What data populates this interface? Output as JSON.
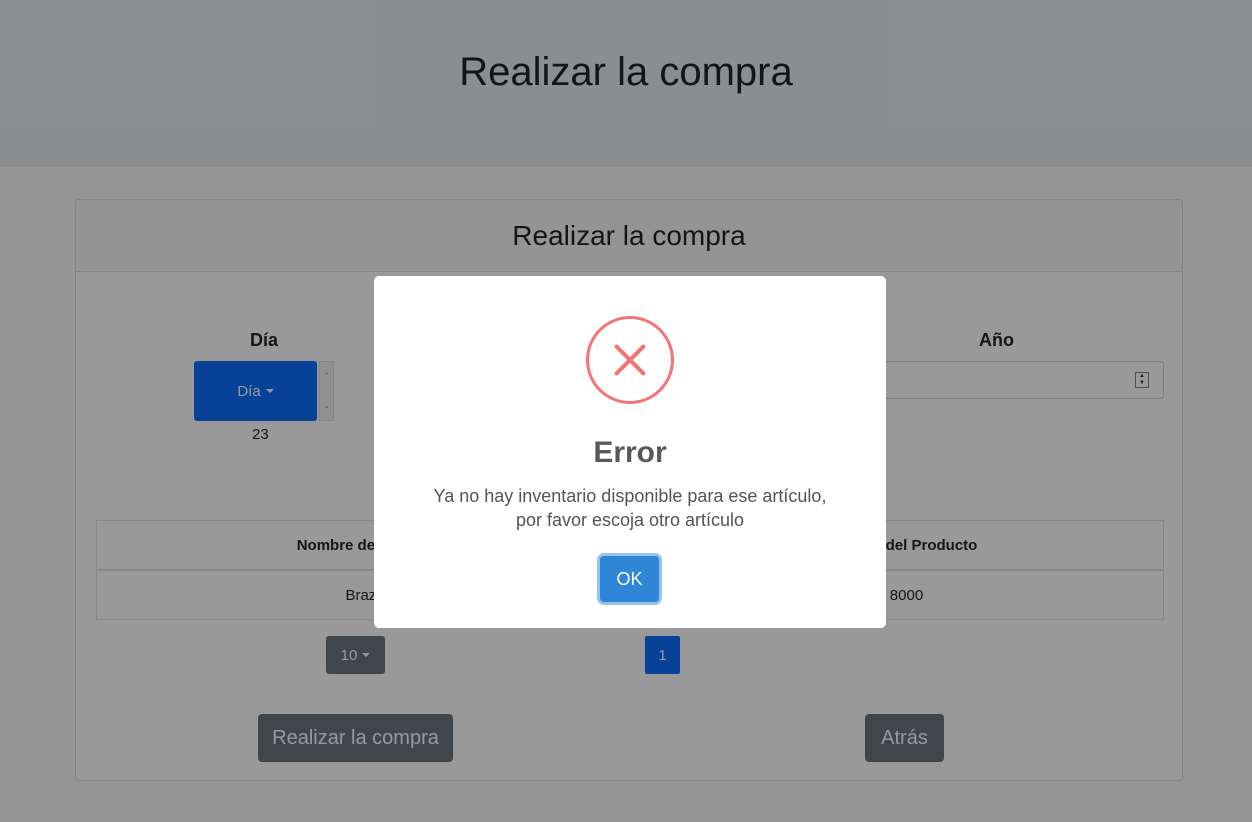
{
  "header": {
    "title": "Realizar la compra"
  },
  "card": {
    "title": "Realizar la compra",
    "dia_label": "Día",
    "dia_button": "Día",
    "dia_value": "23",
    "anio_label": "Año"
  },
  "table": {
    "headers": [
      "Nombre del Producto",
      "Precio del Producto"
    ],
    "rows": [
      {
        "nombre": "Brazuca",
        "precio": "8000"
      }
    ]
  },
  "pagination": {
    "page_size": "10",
    "current_page": "1"
  },
  "actions": {
    "submit": "Realizar la compra",
    "back": "Atrás"
  },
  "modal": {
    "icon": "error-x-icon",
    "title": "Error",
    "message_line1": "Ya no hay inventario disponible para ese artículo,",
    "message_line2": "por favor escoja otro artículo",
    "ok": "OK"
  },
  "colors": {
    "primary": "#0d6efd",
    "secondary": "#6c757d",
    "error": "#f27474",
    "ok": "#3085d6"
  }
}
